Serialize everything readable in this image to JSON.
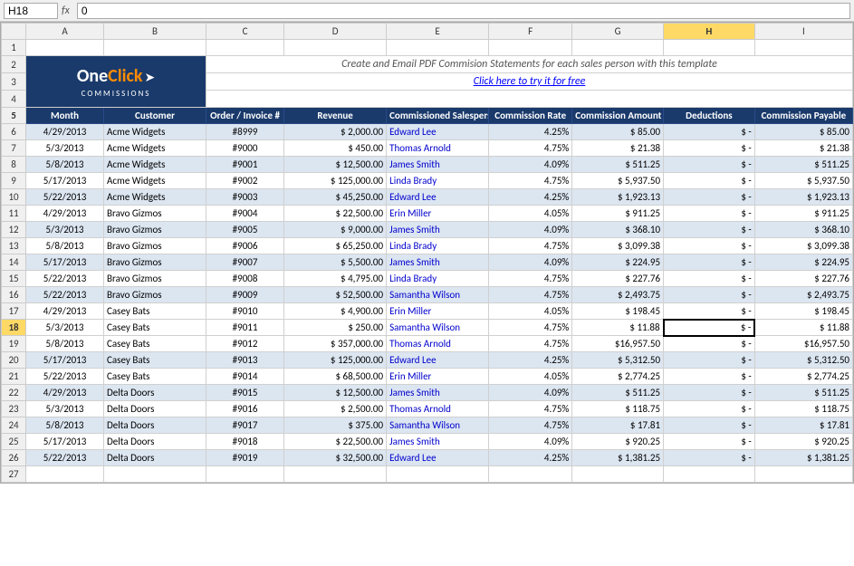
{
  "formula_bar": {
    "cell_ref": "H18",
    "fx_label": "fx",
    "formula_value": "0"
  },
  "columns": {
    "row_num": "",
    "a": "A",
    "b": "B",
    "c": "C",
    "d": "D",
    "e": "E",
    "f": "F",
    "g": "G",
    "h": "H",
    "i": "I"
  },
  "promo": {
    "tagline": "Create and Email PDF Commision Statements for each sales person with this template",
    "link_text": "Click here to try it for free"
  },
  "headers": {
    "month": "Month",
    "customer": "Customer",
    "order_invoice": "Order / Invoice #",
    "revenue": "Revenue",
    "commissioned_salesperson": "Commissioned Salesperson",
    "commission_rate": "Commission Rate",
    "commission_amount": "Commission Amount",
    "deductions": "Deductions",
    "commission_payable": "Commission Payable"
  },
  "rows": [
    {
      "num": 6,
      "month": "4/29/2013",
      "customer": "Acme Widgets",
      "order": "#8999",
      "revenue": "$  2,000.00",
      "salesperson": "Edward Lee",
      "rate": "4.25%",
      "amount": "$   85.00",
      "deductions": "$          -",
      "payable": "$   85.00",
      "even": true
    },
    {
      "num": 7,
      "month": "5/3/2013",
      "customer": "Acme Widgets",
      "order": "#9000",
      "revenue": "$     450.00",
      "salesperson": "Thomas Arnold",
      "rate": "4.75%",
      "amount": "$   21.38",
      "deductions": "$          -",
      "payable": "$   21.38",
      "even": false
    },
    {
      "num": 8,
      "month": "5/8/2013",
      "customer": "Acme Widgets",
      "order": "#9001",
      "revenue": "$  12,500.00",
      "salesperson": "James Smith",
      "rate": "4.09%",
      "amount": "$  511.25",
      "deductions": "$          -",
      "payable": "$  511.25",
      "even": true
    },
    {
      "num": 9,
      "month": "5/17/2013",
      "customer": "Acme Widgets",
      "order": "#9002",
      "revenue": "$ 125,000.00",
      "salesperson": "Linda Brady",
      "rate": "4.75%",
      "amount": "$ 5,937.50",
      "deductions": "$          -",
      "payable": "$ 5,937.50",
      "even": false
    },
    {
      "num": 10,
      "month": "5/22/2013",
      "customer": "Acme Widgets",
      "order": "#9003",
      "revenue": "$  45,250.00",
      "salesperson": "Edward Lee",
      "rate": "4.25%",
      "amount": "$ 1,923.13",
      "deductions": "$          -",
      "payable": "$ 1,923.13",
      "even": true
    },
    {
      "num": 11,
      "month": "4/29/2013",
      "customer": "Bravo Gizmos",
      "order": "#9004",
      "revenue": "$  22,500.00",
      "salesperson": "Erin Miller",
      "rate": "4.05%",
      "amount": "$  911.25",
      "deductions": "$          -",
      "payable": "$  911.25",
      "even": false
    },
    {
      "num": 12,
      "month": "5/3/2013",
      "customer": "Bravo Gizmos",
      "order": "#9005",
      "revenue": "$   9,000.00",
      "salesperson": "James Smith",
      "rate": "4.09%",
      "amount": "$  368.10",
      "deductions": "$          -",
      "payable": "$  368.10",
      "even": true
    },
    {
      "num": 13,
      "month": "5/8/2013",
      "customer": "Bravo Gizmos",
      "order": "#9006",
      "revenue": "$  65,250.00",
      "salesperson": "Linda Brady",
      "rate": "4.75%",
      "amount": "$ 3,099.38",
      "deductions": "$          -",
      "payable": "$ 3,099.38",
      "even": false
    },
    {
      "num": 14,
      "month": "5/17/2013",
      "customer": "Bravo Gizmos",
      "order": "#9007",
      "revenue": "$   5,500.00",
      "salesperson": "James Smith",
      "rate": "4.09%",
      "amount": "$  224.95",
      "deductions": "$          -",
      "payable": "$  224.95",
      "even": true
    },
    {
      "num": 15,
      "month": "5/22/2013",
      "customer": "Bravo Gizmos",
      "order": "#9008",
      "revenue": "$   4,795.00",
      "salesperson": "Linda Brady",
      "rate": "4.75%",
      "amount": "$  227.76",
      "deductions": "$          -",
      "payable": "$  227.76",
      "even": false
    },
    {
      "num": 16,
      "month": "5/22/2013",
      "customer": "Bravo Gizmos",
      "order": "#9009",
      "revenue": "$  52,500.00",
      "salesperson": "Samantha Wilson",
      "rate": "4.75%",
      "amount": "$ 2,493.75",
      "deductions": "$          -",
      "payable": "$ 2,493.75",
      "even": true
    },
    {
      "num": 17,
      "month": "4/29/2013",
      "customer": "Casey Bats",
      "order": "#9010",
      "revenue": "$   4,900.00",
      "salesperson": "Erin Miller",
      "rate": "4.05%",
      "amount": "$  198.45",
      "deductions": "$          -",
      "payable": "$  198.45",
      "even": false
    },
    {
      "num": 18,
      "month": "5/3/2013",
      "customer": "Casey Bats",
      "order": "#9011",
      "revenue": "$     250.00",
      "salesperson": "Samantha Wilson",
      "rate": "4.75%",
      "amount": "$   11.88",
      "deductions": "$          -",
      "payable": "$   11.88",
      "even": true,
      "selected": true
    },
    {
      "num": 19,
      "month": "5/8/2013",
      "customer": "Casey Bats",
      "order": "#9012",
      "revenue": "$ 357,000.00",
      "salesperson": "Thomas Arnold",
      "rate": "4.75%",
      "amount": "$16,957.50",
      "deductions": "$          -",
      "payable": "$16,957.50",
      "even": false
    },
    {
      "num": 20,
      "month": "5/17/2013",
      "customer": "Casey Bats",
      "order": "#9013",
      "revenue": "$ 125,000.00",
      "salesperson": "Edward Lee",
      "rate": "4.25%",
      "amount": "$ 5,312.50",
      "deductions": "$          -",
      "payable": "$ 5,312.50",
      "even": true
    },
    {
      "num": 21,
      "month": "5/22/2013",
      "customer": "Casey Bats",
      "order": "#9014",
      "revenue": "$  68,500.00",
      "salesperson": "Erin Miller",
      "rate": "4.05%",
      "amount": "$ 2,774.25",
      "deductions": "$          -",
      "payable": "$ 2,774.25",
      "even": false
    },
    {
      "num": 22,
      "month": "4/29/2013",
      "customer": "Delta Doors",
      "order": "#9015",
      "revenue": "$  12,500.00",
      "salesperson": "James Smith",
      "rate": "4.09%",
      "amount": "$  511.25",
      "deductions": "$          -",
      "payable": "$  511.25",
      "even": true
    },
    {
      "num": 23,
      "month": "5/3/2013",
      "customer": "Delta Doors",
      "order": "#9016",
      "revenue": "$   2,500.00",
      "salesperson": "Thomas Arnold",
      "rate": "4.75%",
      "amount": "$  118.75",
      "deductions": "$          -",
      "payable": "$  118.75",
      "even": false
    },
    {
      "num": 24,
      "month": "5/8/2013",
      "customer": "Delta Doors",
      "order": "#9017",
      "revenue": "$     375.00",
      "salesperson": "Samantha Wilson",
      "rate": "4.75%",
      "amount": "$   17.81",
      "deductions": "$          -",
      "payable": "$   17.81",
      "even": true
    },
    {
      "num": 25,
      "month": "5/17/2013",
      "customer": "Delta Doors",
      "order": "#9018",
      "revenue": "$  22,500.00",
      "salesperson": "James Smith",
      "rate": "4.09%",
      "amount": "$  920.25",
      "deductions": "$          -",
      "payable": "$  920.25",
      "even": false
    },
    {
      "num": 26,
      "month": "5/22/2013",
      "customer": "Delta Doors",
      "order": "#9019",
      "revenue": "$  32,500.00",
      "salesperson": "Edward Lee",
      "rate": "4.25%",
      "amount": "$ 1,381.25",
      "deductions": "$          -",
      "payable": "$ 1,381.25",
      "even": true
    },
    {
      "num": 27,
      "month": "",
      "customer": "",
      "order": "",
      "revenue": "",
      "salesperson": "",
      "rate": "",
      "amount": "",
      "deductions": "",
      "payable": "",
      "even": false
    }
  ]
}
